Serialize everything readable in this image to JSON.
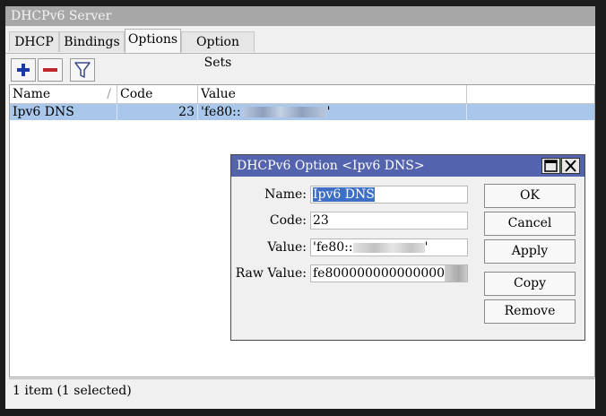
{
  "window": {
    "title": "DHCPv6 Server"
  },
  "tabs": [
    {
      "label": "DHCP"
    },
    {
      "label": "Bindings"
    },
    {
      "label": "Options"
    },
    {
      "label": "Option Sets"
    }
  ],
  "toolbar": {
    "add": "add-icon",
    "remove": "remove-icon",
    "filter": "filter-icon"
  },
  "table": {
    "columns": [
      "Name",
      "Code",
      "Value"
    ],
    "rows": [
      {
        "name": "Ipv6 DNS",
        "code": "23",
        "value_prefix": "'fe80::",
        "value_suffix": "'"
      }
    ]
  },
  "status": {
    "text": "1 item (1 selected)"
  },
  "dialog": {
    "title": "DHCPv6 Option <Ipv6 DNS>",
    "fields": {
      "name_label": "Name:",
      "name_value": "Ipv6 DNS",
      "code_label": "Code:",
      "code_value": "23",
      "value_label": "Value:",
      "value_prefix": "'fe80::",
      "value_suffix": "'",
      "raw_label": "Raw Value:",
      "raw_prefix": "fe800000000000000"
    },
    "buttons": {
      "ok": "OK",
      "cancel": "Cancel",
      "apply": "Apply",
      "copy": "Copy",
      "remove": "Remove"
    }
  },
  "colors": {
    "accent": "#5363ad",
    "selection": "#a9c7ea"
  }
}
